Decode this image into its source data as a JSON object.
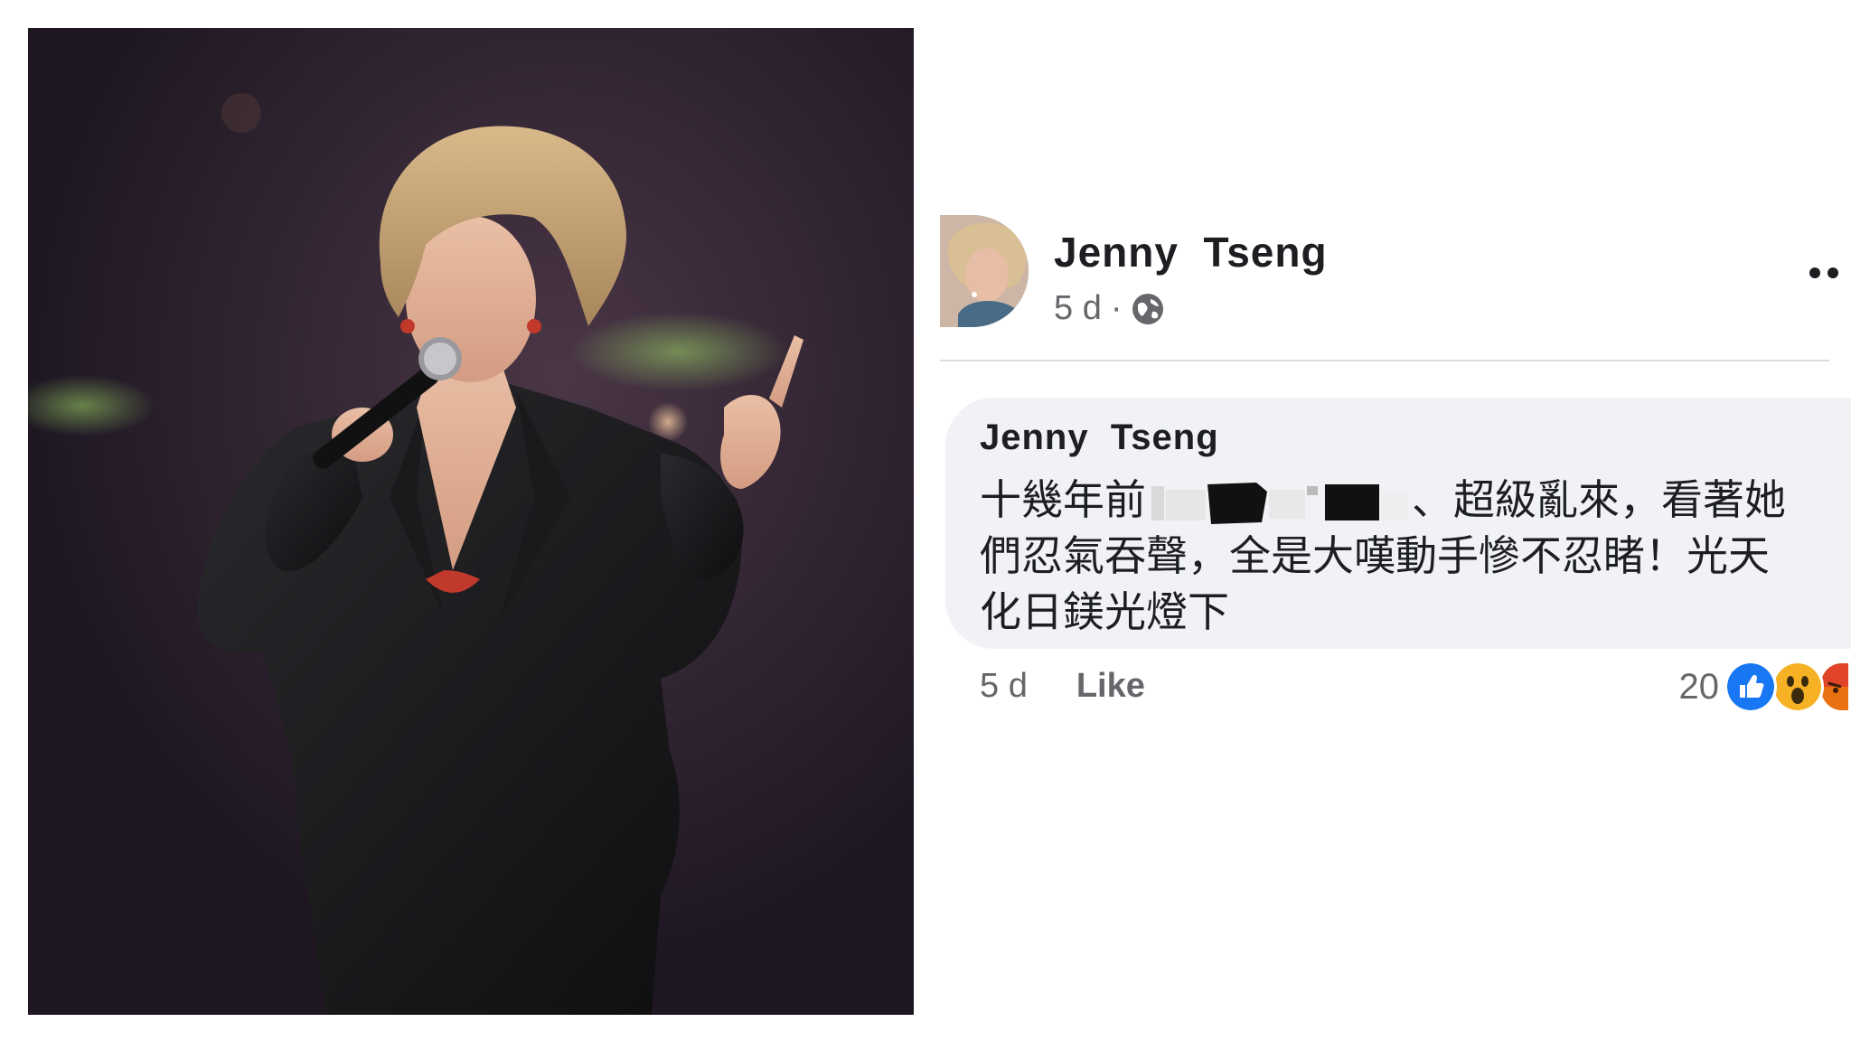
{
  "photo": {
    "description_icon": "singer-photo"
  },
  "post": {
    "author": "Jenny  Tseng",
    "time": "5 d",
    "separator": "·",
    "privacy_icon": "globe-icon",
    "more_icon": "more-options-icon"
  },
  "comment": {
    "author": "Jenny  Tseng",
    "text_line1_start": "十幾年前",
    "text_line1_end": "、超級亂來，看著她",
    "text_line2": "們忍氣吞聲，全是大嘆動手慘不忍睹！光天",
    "text_line3": "化日鎂光燈下",
    "time": "5 d",
    "like_label": "Like",
    "reaction_count": "20",
    "reactions": [
      "like-reaction-icon",
      "wow-reaction-icon",
      "angry-reaction-icon"
    ]
  },
  "colors": {
    "bubble": "#f0f2f5",
    "text_primary": "#1c1e21",
    "text_secondary": "#65676b",
    "like_blue": "#1877f2",
    "wow_yellow": "#f7b125",
    "angry_orange": "#e9710f"
  }
}
